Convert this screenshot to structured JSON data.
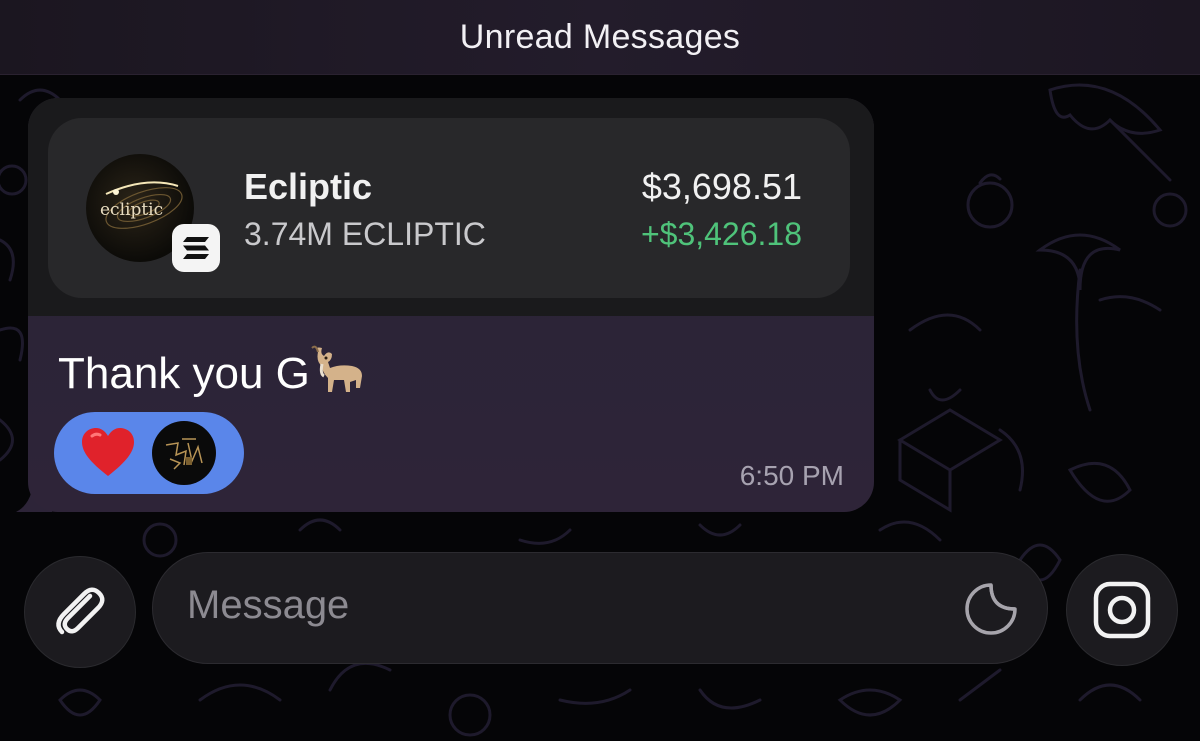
{
  "banner": {
    "unread_label": "Unread Messages"
  },
  "message": {
    "token_card": {
      "logo_text": "ecliptic",
      "name": "Ecliptic",
      "amount": "3.74M ECLIPTIC",
      "value": "$3,698.51",
      "change": "+$3,426.18",
      "change_color": "#4fc37a",
      "chain_icon": "solana-icon"
    },
    "text": "Thank you G",
    "emoji_icon": "goat-icon",
    "reactions": {
      "emoji": "red-heart-icon",
      "pill_color": "#5a86ea",
      "reactor_avatar": "avatar"
    },
    "time": "6:50 PM"
  },
  "composer": {
    "placeholder": "Message",
    "attach_icon": "paperclip-icon",
    "sticker_icon": "sticker-icon",
    "camera_icon": "camera-icon"
  },
  "colors": {
    "background": "#050507",
    "bubble": "#2b2437",
    "card": "#28282a",
    "doodle": "#1e1a2c"
  }
}
